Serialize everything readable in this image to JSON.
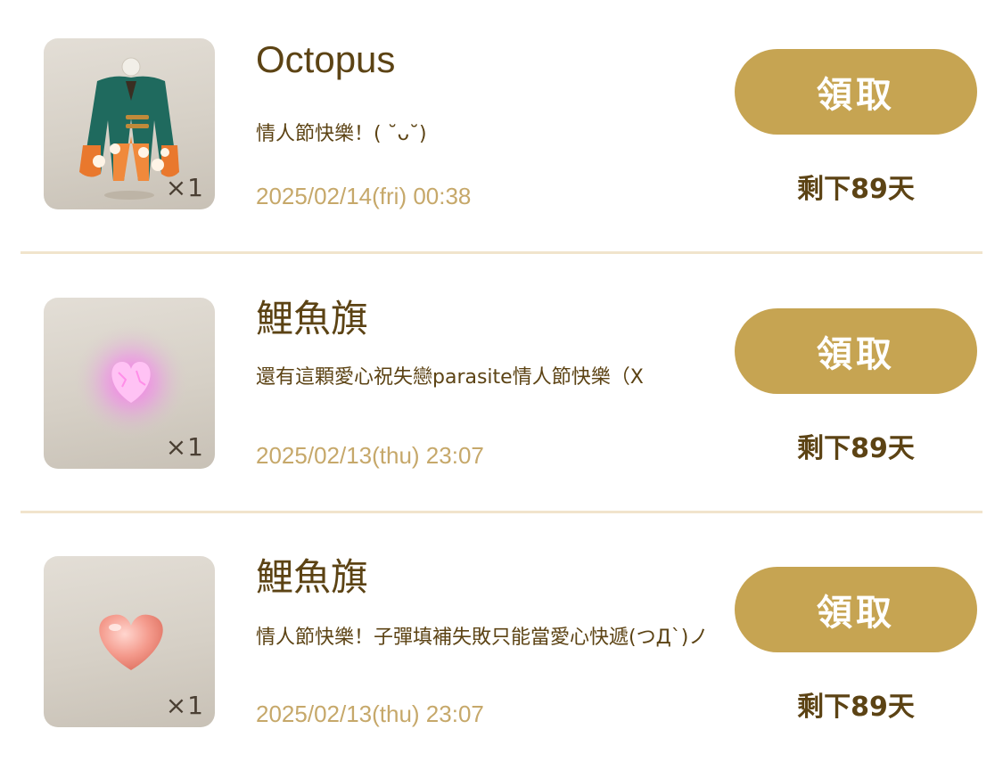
{
  "gifts": [
    {
      "sender": "Octopus",
      "message": "情人節快樂！( ˘ᴗ˘)",
      "timestamp": "2025/02/14(fri) 00:38",
      "quantity": "×1",
      "item_icon": "kimono-outfit-icon",
      "claim_label": "領取",
      "remaining": "剩下89天"
    },
    {
      "sender": "鯉魚旗",
      "message": "還有這顆愛心祝失戀parasite情人節快樂（X",
      "timestamp": "2025/02/13(thu) 23:07",
      "quantity": "×1",
      "item_icon": "glowing-heart-icon",
      "claim_label": "領取",
      "remaining": "剩下89天"
    },
    {
      "sender": "鯉魚旗",
      "message": "情人節快樂！子彈填補失敗只能當愛心快遞(つД`)ノ",
      "timestamp": "2025/02/13(thu) 23:07",
      "quantity": "×1",
      "item_icon": "pink-heart-icon",
      "claim_label": "領取",
      "remaining": "剩下89天"
    }
  ],
  "colors": {
    "button": "#c6a452",
    "title_text": "#5c4314",
    "timestamp_text": "#c6a86a",
    "divider": "#f1e4cc"
  }
}
